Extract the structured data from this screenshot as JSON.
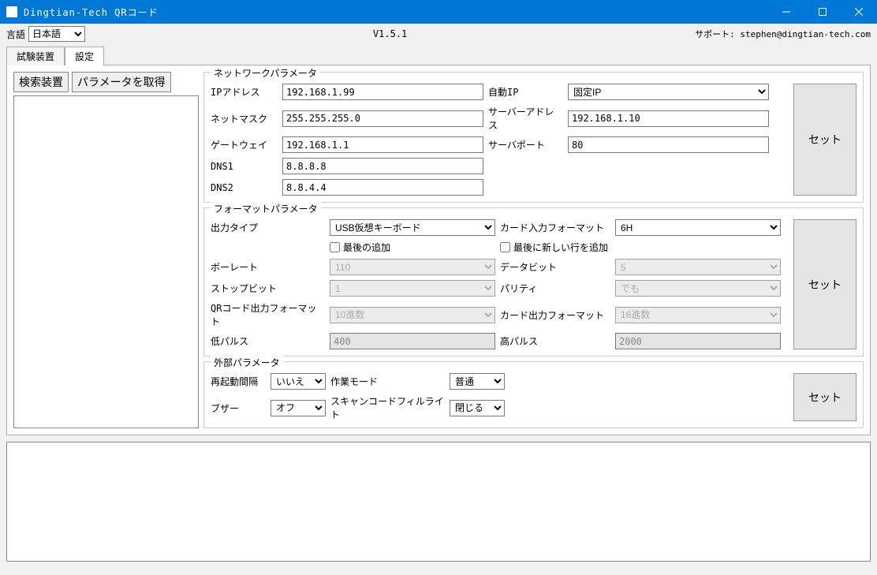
{
  "window": {
    "title": "Dingtian-Tech QRコード"
  },
  "topbar": {
    "lang_label": "言語",
    "lang_value": "日本語",
    "version": "V1.5.1",
    "support": "サポート: stephen@dingtian-tech.com"
  },
  "tabs": {
    "test_device": "試験装置",
    "settings": "設定"
  },
  "side": {
    "search_device": "検索装置",
    "get_params": "パラメータを取得"
  },
  "network": {
    "title": "ネットワークパラメータ",
    "ip_label": "IPアドレス",
    "ip_value": "192.168.1.99",
    "auto_ip_label": "自動IP",
    "auto_ip_value": "固定IP",
    "netmask_label": "ネットマスク",
    "netmask_value": "255.255.255.0",
    "server_addr_label": "サーバーアドレス",
    "server_addr_value": "192.168.1.10",
    "gateway_label": "ゲートウェイ",
    "gateway_value": "192.168.1.1",
    "server_port_label": "サーバポート",
    "server_port_value": "80",
    "dns1_label": "DNS1",
    "dns1_value": "8.8.8.8",
    "dns2_label": "DNS2",
    "dns2_value": "8.8.4.4",
    "set_btn": "セット"
  },
  "format": {
    "title": "フォーマットパラメータ",
    "output_type_label": "出力タイプ",
    "output_type_value": "USB仮想キーボード",
    "card_input_fmt_label": "カード入力フォーマット",
    "card_input_fmt_value": "6H",
    "append_last": "最後の追加",
    "append_newline": "最後に新しい行を追加",
    "baud_label": "ボーレート",
    "baud_value": "110",
    "databit_label": "データビット",
    "databit_value": "5",
    "stopbit_label": "ストップビット",
    "stopbit_value": "1",
    "parity_label": "パリティ",
    "parity_value": "でも",
    "qr_out_fmt_label": "QRコード出力フォーマット",
    "qr_out_fmt_value": "10進数",
    "card_out_fmt_label": "カード出力フォーマット",
    "card_out_fmt_value": "16進数",
    "low_pulse_label": "低パルス",
    "low_pulse_value": "400",
    "high_pulse_label": "高パルス",
    "high_pulse_value": "2000",
    "set_btn": "セット"
  },
  "external": {
    "title": "外部パラメータ",
    "reboot_interval_label": "再起動間隔",
    "reboot_interval_value": "いいえ",
    "work_mode_label": "作業モード",
    "work_mode_value": "普通",
    "buzzer_label": "ブザー",
    "buzzer_value": "オフ",
    "scan_fill_light_label": "スキャンコードフィルライト",
    "scan_fill_light_value": "閉じる",
    "set_btn": "セット"
  }
}
